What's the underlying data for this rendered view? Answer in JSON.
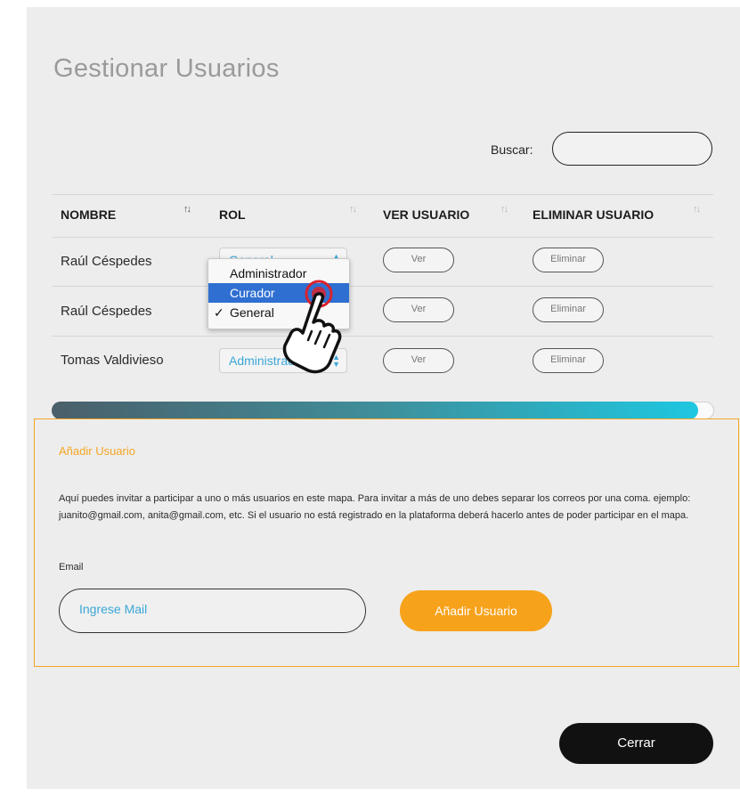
{
  "title": "Gestionar Usuarios",
  "search": {
    "label": "Buscar:",
    "value": ""
  },
  "table": {
    "headers": [
      "NOMBRE",
      "ROL",
      "VER USUARIO",
      "ELIMINAR USUARIO"
    ],
    "sort_symbol": "↑↓",
    "rows": [
      {
        "name": "Raúl Céspedes",
        "role": "General",
        "view": "Ver",
        "delete": "Eliminar"
      },
      {
        "name": "Raúl Céspedes",
        "role": "General",
        "view": "Ver",
        "delete": "Eliminar"
      },
      {
        "name": "Tomas Valdivieso",
        "role": "Administrador",
        "view": "Ver",
        "delete": "Eliminar"
      }
    ]
  },
  "dropdown": {
    "options": [
      "Administrador",
      "Curador",
      "General"
    ],
    "highlighted": "Curador",
    "checked": "General",
    "check_mark": "✓"
  },
  "add_user": {
    "title": "Añadir Usuario",
    "description": "Aquí puedes invitar a participar a uno o más usuarios en este mapa. Para invitar a más de uno debes separar los correos por una coma. ejemplo: juanito@gmail.com, anita@gmail.com, etc. Si el usuario no está registrado en la plataforma deberá hacerlo antes de poder participar en el mapa.",
    "email_label": "Email",
    "email_placeholder": "Ingrese Mail",
    "button_label": "Añadir Usuario"
  },
  "close_label": "Cerrar",
  "colors": {
    "accent_orange": "#f5a623",
    "link_blue": "#3aa7d6",
    "selection_blue": "#2f6fd1"
  }
}
